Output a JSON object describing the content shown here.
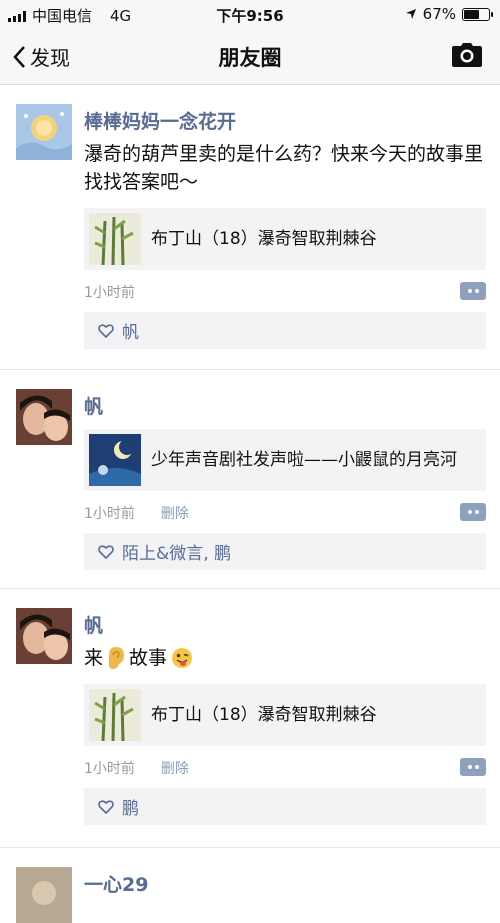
{
  "status": {
    "carrier": "中国电信",
    "network": "4G",
    "time": "下午9:56",
    "battery": "67%",
    "battery_level": 0.67
  },
  "nav": {
    "back_label": "发现",
    "title": "朋友圈"
  },
  "posts": [
    {
      "username": "棒棒妈妈一念花开",
      "text": "瀑奇的葫芦里卖的是什么药？快来今天的故事里找找答案吧～",
      "link_title": "布丁山（18）瀑奇智取荆棘谷",
      "time": "1小时前",
      "likes": "帆"
    },
    {
      "username": "帆",
      "link_title": "少年声音剧社发声啦——小鼹鼠的月亮河",
      "time": "1小时前",
      "delete": "删除",
      "likes": "陌上&微言, 鹏"
    },
    {
      "username": "帆",
      "text_prefix": "来",
      "text_middle": "故事",
      "link_title": "布丁山（18）瀑奇智取荆棘谷",
      "time": "1小时前",
      "delete": "删除",
      "likes": "鹏"
    },
    {
      "username": "一心29"
    }
  ]
}
